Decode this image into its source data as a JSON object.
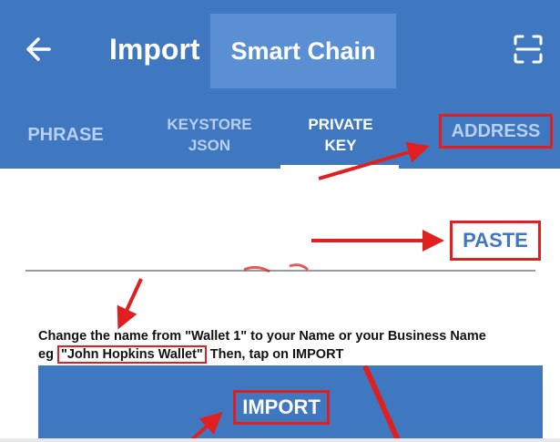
{
  "header": {
    "title": "Import",
    "chain_name": "Smart Chain",
    "back_icon": "back-arrow-icon",
    "scan_icon": "scan-icon"
  },
  "tabs": [
    {
      "label": "PHRASE",
      "active": false
    },
    {
      "label": "KEYSTORE\nJSON",
      "active": false
    },
    {
      "label": "PRIVATE\nKEY",
      "active": true
    },
    {
      "label": "ADDRESS",
      "active": false
    }
  ],
  "paste_label": "PASTE",
  "instruction": {
    "line1": "Change the name from \"Wallet 1\" to your Name or your Business Name",
    "prefix": "eg ",
    "example": "\"John Hopkins Wallet\"",
    "suffix": " Then, tap on IMPORT"
  },
  "import_label": "IMPORT",
  "colors": {
    "primary": "#3f78c0",
    "annotation": "#e02020"
  }
}
